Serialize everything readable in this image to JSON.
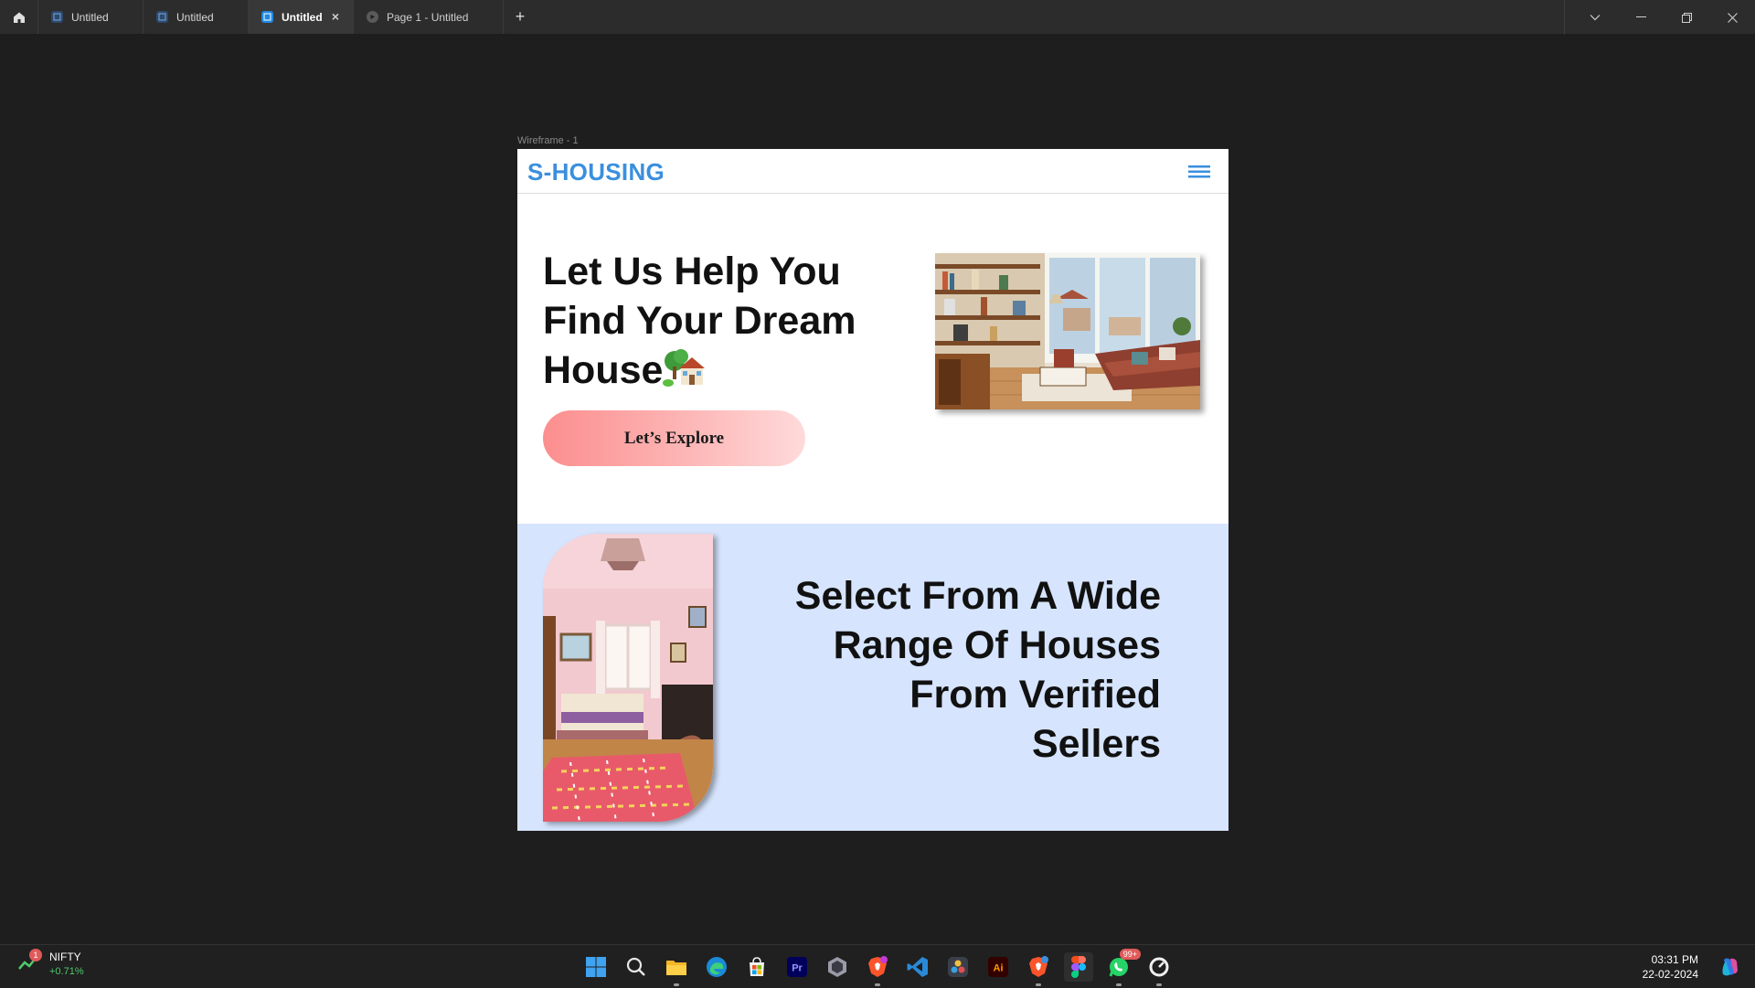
{
  "tabs": [
    {
      "label": "Untitled",
      "active": false
    },
    {
      "label": "Untitled",
      "active": false
    },
    {
      "label": "Untitled",
      "active": true
    },
    {
      "label": "Page 1 - Untitled",
      "active": false
    }
  ],
  "new_tab_label": "+",
  "close_tab_label": "×",
  "frame": {
    "label": "Wireframe - 1"
  },
  "site": {
    "logo": "S-HOUSING",
    "hero_title": "Let Us Help You Find Your Dream House",
    "house_emoji_icon": "house-with-garden-icon",
    "explore_button": "Let’s Explore",
    "section2_title": "Select From A Wide Range Of Houses From Verified Sellers"
  },
  "colors": {
    "brand_blue": "#3a8fde",
    "button_pink": "#fc8e8e",
    "section2_bg": "#d6e4fd",
    "app_bg": "#1e1e1e",
    "active_tab_icon": "#1e88e5"
  },
  "taskbar": {
    "widget": {
      "name": "NIFTY",
      "change": "+0.71%",
      "badge": "1"
    },
    "apps": [
      {
        "name": "windows-start-icon"
      },
      {
        "name": "search-icon"
      },
      {
        "name": "file-explorer-icon"
      },
      {
        "name": "edge-browser-icon"
      },
      {
        "name": "microsoft-store-icon"
      },
      {
        "name": "premiere-pro-icon",
        "label": "Pr"
      },
      {
        "name": "hexagon-app-icon"
      },
      {
        "name": "brave-browser-icon"
      },
      {
        "name": "vscode-icon"
      },
      {
        "name": "davinci-resolve-icon"
      },
      {
        "name": "illustrator-icon",
        "label": "Ai"
      },
      {
        "name": "brave-browser-icon-2"
      },
      {
        "name": "figma-icon"
      },
      {
        "name": "whatsapp-icon",
        "badge": "99+"
      },
      {
        "name": "clock-app-icon"
      }
    ],
    "time": "03:31 PM",
    "date": "22-02-2024"
  }
}
